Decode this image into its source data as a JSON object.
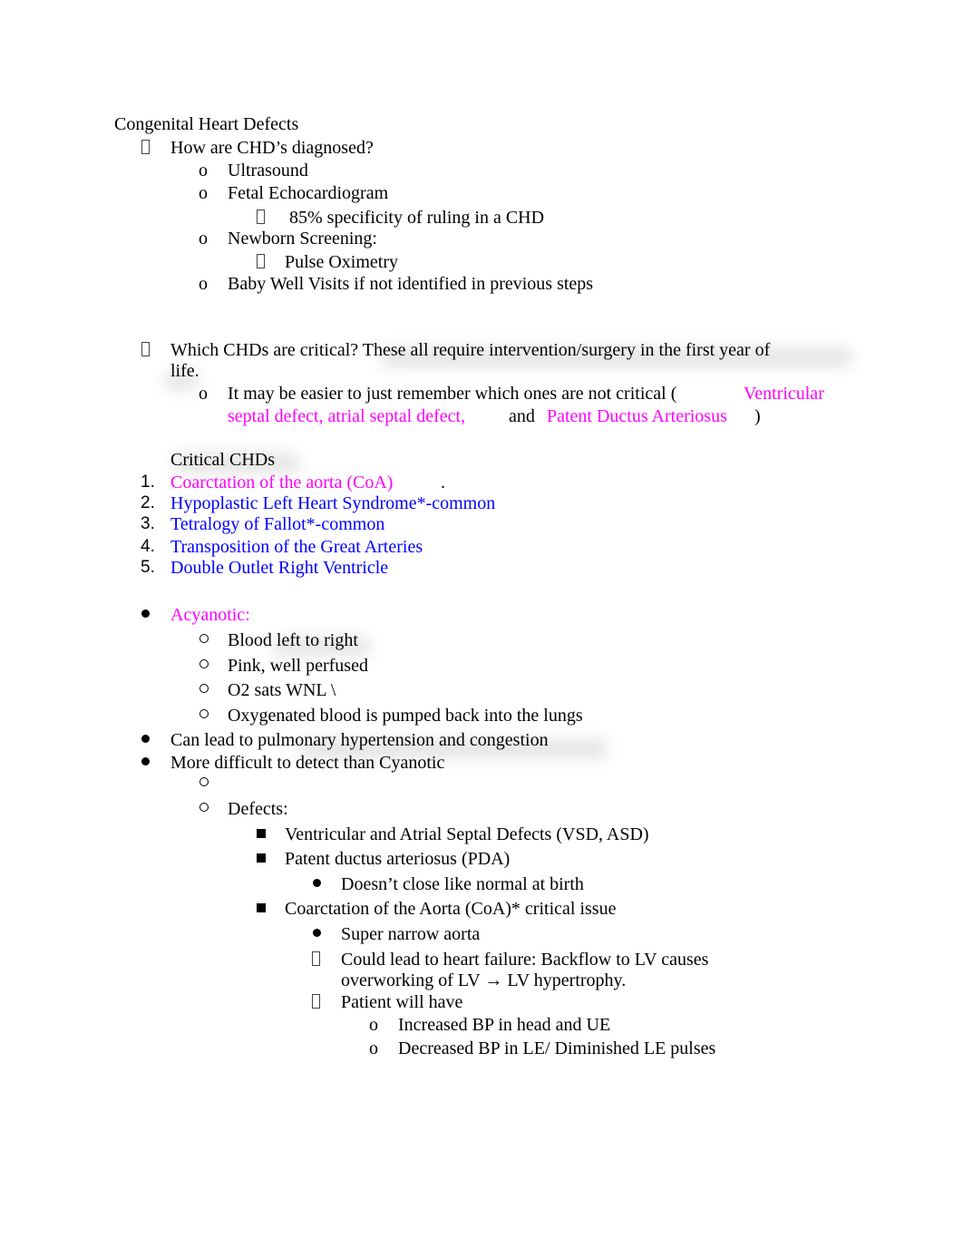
{
  "document": {
    "title": "Congenital Heart Defects",
    "diagnosis": {
      "question": "How are CHD’s diagnosed?",
      "items": [
        {
          "label": "Ultrasound"
        },
        {
          "label": "Fetal Echocardiogram",
          "sub": "85% specificity of ruling in a CHD"
        },
        {
          "label": "Newborn Screening:",
          "sub": "Pulse Oximetry"
        },
        {
          "label": "Baby Well Visits if not identified in previous steps"
        }
      ]
    },
    "critical_question": {
      "line1": "Which CHDs are critical? These all require intervention/surgery in the first year of",
      "line2": "life.",
      "note_prefix": "It may be easier to just remember which ones are not critical (",
      "note_vsd": "Ventricular",
      "note_line2_a": "septal defect, atrial septal defect,",
      "note_and": "and",
      "note_pda": "Patent Ductus Arteriosus",
      "note_close": ")"
    },
    "critical_chds": {
      "heading": "Critical CHDs",
      "items": [
        {
          "num": "1.",
          "label": "Coarctation of the aorta (CoA)",
          "suffix": ".",
          "color": "#ff00ff"
        },
        {
          "num": "2.",
          "label": "Hypoplastic Left Heart Syndrome*-common",
          "color": "#0000ff"
        },
        {
          "num": "3.",
          "label": "Tetralogy of Fallot*-common",
          "color": "#0000ff"
        },
        {
          "num": "4.",
          "label": "Transposition of the Great Arteries",
          "color": "#0000ff"
        },
        {
          "num": "5.",
          "label": "Double Outlet Right Ventricle",
          "color": "#0000ff"
        }
      ]
    },
    "acyanotic": {
      "heading": "Acyanotic:",
      "traits": [
        "Blood left to right",
        "Pink, well perfused",
        "O2 sats WNL \\",
        "Oxygenated blood is pumped back into the lungs"
      ],
      "points": [
        "Can lead to pulmonary hypertension and congestion",
        "More difficult to detect than Cyanotic"
      ],
      "empty_item": "",
      "defects_label": "Defects:",
      "defects": [
        "Ventricular and Atrial Septal Defects (VSD, ASD)",
        "Patent ductus arteriosus (PDA)",
        "Coarctation of the Aorta (CoA)* critical issue"
      ],
      "pda_note": "Doesn’t close like normal at birth",
      "coa_notes": {
        "narrow": "Super narrow aorta",
        "failure_line1": "Could lead to heart failure: Backflow to LV causes",
        "failure_line2": "overworking of LV → LV hypertrophy.",
        "patient": "Patient will have",
        "findings": [
          "Increased BP in head and UE",
          "Decreased BP in LE/ Diminished LE pulses"
        ]
      }
    }
  },
  "colors": {
    "highlight_magenta": "#ff00ff",
    "list_blue": "#0000ff"
  }
}
